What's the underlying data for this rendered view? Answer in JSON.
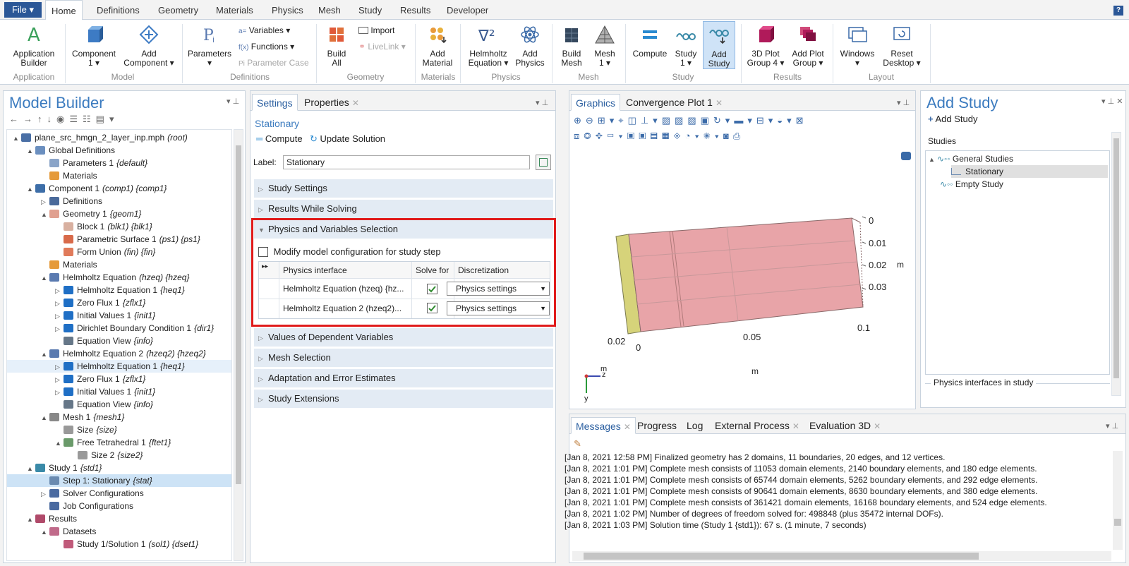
{
  "ribbon": {
    "file_label": "File ▾",
    "tabs": [
      "Home",
      "Definitions",
      "Geometry",
      "Materials",
      "Physics",
      "Mesh",
      "Study",
      "Results",
      "Developer"
    ],
    "help_label": "?",
    "groups": {
      "application": "Application",
      "model": "Model",
      "definitions": "Definitions",
      "geometry": "Geometry",
      "materials": "Materials",
      "physics": "Physics",
      "mesh": "Mesh",
      "study": "Study",
      "results": "Results",
      "layout": "Layout"
    },
    "buttons": {
      "app_builder_1": "Application",
      "app_builder_2": "Builder",
      "component_1": "Component",
      "component_2": "1 ▾",
      "add_component_1": "Add",
      "add_component_2": "Component ▾",
      "parameters_1": "Parameters",
      "parameters_2": "▾",
      "variables": "Variables ▾",
      "functions": "Functions ▾",
      "parameter_case": "Parameter Case",
      "build_all_1": "Build",
      "build_all_2": "All",
      "import": "Import",
      "livelink": "LiveLink ▾",
      "add_material_1": "Add",
      "add_material_2": "Material",
      "helmholtz_1": "Helmholtz",
      "helmholtz_2": "Equation ▾",
      "add_physics_1": "Add",
      "add_physics_2": "Physics",
      "build_mesh_1": "Build",
      "build_mesh_2": "Mesh",
      "mesh_1": "Mesh",
      "mesh_2": "1 ▾",
      "compute": "Compute",
      "study_1": "Study",
      "study_2": "1 ▾",
      "add_study_1": "Add",
      "add_study_2": "Study",
      "plot3d_1": "3D Plot",
      "plot3d_2": "Group 4 ▾",
      "add_plot_1": "Add Plot",
      "add_plot_2": "Group ▾",
      "windows_1": "Windows",
      "windows_2": "▾",
      "reset_1": "Reset",
      "reset_2": "Desktop ▾"
    }
  },
  "model_builder": {
    "title": "Model Builder",
    "tree": [
      {
        "level": 0,
        "tw": "▲",
        "label": "plane_src_hmgn_2_layer_inp.mph",
        "tag": "(root)",
        "icon": "#4a6fa5"
      },
      {
        "level": 1,
        "tw": "▲",
        "label": "Global Definitions",
        "tag": "",
        "icon": "#6b8fbf"
      },
      {
        "level": 2,
        "tw": "",
        "label": "Parameters 1",
        "tag": "{default}",
        "icon": "#8aa4c8"
      },
      {
        "level": 2,
        "tw": "",
        "label": "Materials",
        "tag": "",
        "icon": "#e59a3a"
      },
      {
        "level": 1,
        "tw": "▲",
        "label": "Component 1",
        "tag": "(comp1) {comp1}",
        "icon": "#3d6ea8"
      },
      {
        "level": 2,
        "tw": "▷",
        "label": "Definitions",
        "tag": "",
        "icon": "#4a6a9a"
      },
      {
        "level": 2,
        "tw": "▲",
        "label": "Geometry 1",
        "tag": "{geom1}",
        "icon": "#e0a090"
      },
      {
        "level": 3,
        "tw": "",
        "label": "Block 1",
        "tag": "(blk1) {blk1}",
        "icon": "#d8b0a0"
      },
      {
        "level": 3,
        "tw": "",
        "label": "Parametric Surface 1",
        "tag": "(ps1) {ps1}",
        "icon": "#d86a4a"
      },
      {
        "level": 3,
        "tw": "",
        "label": "Form Union",
        "tag": "(fin) {fin}",
        "icon": "#e07a5a"
      },
      {
        "level": 2,
        "tw": "",
        "label": "Materials",
        "tag": "",
        "icon": "#e59a3a"
      },
      {
        "level": 2,
        "tw": "▲",
        "label": "Helmholtz Equation",
        "tag": "(hzeq) {hzeq}",
        "icon": "#5a7ab0"
      },
      {
        "level": 3,
        "tw": "▷",
        "label": "Helmholtz Equation 1",
        "tag": "{heq1}",
        "icon": "#1f6fc5"
      },
      {
        "level": 3,
        "tw": "▷",
        "label": "Zero Flux 1",
        "tag": "{zflx1}",
        "icon": "#1f6fc5"
      },
      {
        "level": 3,
        "tw": "▷",
        "label": "Initial Values 1",
        "tag": "{init1}",
        "icon": "#1f6fc5"
      },
      {
        "level": 3,
        "tw": "▷",
        "label": "Dirichlet Boundary Condition 1",
        "tag": "{dir1}",
        "icon": "#1f6fc5"
      },
      {
        "level": 3,
        "tw": "",
        "label": "Equation View",
        "tag": "{info}",
        "icon": "#667788"
      },
      {
        "level": 2,
        "tw": "▲",
        "label": "Helmholtz Equation 2",
        "tag": "(hzeq2) {hzeq2}",
        "icon": "#5a7ab0"
      },
      {
        "level": 3,
        "tw": "▷",
        "label": "Helmholtz Equation 1",
        "tag": "{heq1}",
        "icon": "#1f6fc5",
        "highlight": true
      },
      {
        "level": 3,
        "tw": "▷",
        "label": "Zero Flux 1",
        "tag": "{zflx1}",
        "icon": "#1f6fc5"
      },
      {
        "level": 3,
        "tw": "▷",
        "label": "Initial Values 1",
        "tag": "{init1}",
        "icon": "#1f6fc5"
      },
      {
        "level": 3,
        "tw": "",
        "label": "Equation View",
        "tag": "{info}",
        "icon": "#667788"
      },
      {
        "level": 2,
        "tw": "▲",
        "label": "Mesh 1",
        "tag": "{mesh1}",
        "icon": "#888888"
      },
      {
        "level": 3,
        "tw": "",
        "label": "Size",
        "tag": "{size}",
        "icon": "#999999"
      },
      {
        "level": 3,
        "tw": "▲",
        "label": "Free Tetrahedral 1",
        "tag": "{ftet1}",
        "icon": "#6a9a6a"
      },
      {
        "level": 4,
        "tw": "",
        "label": "Size 2",
        "tag": "{size2}",
        "icon": "#999999"
      },
      {
        "level": 1,
        "tw": "▲",
        "label": "Study 1",
        "tag": "{std1}",
        "icon": "#3a8aa8"
      },
      {
        "level": 2,
        "tw": "",
        "label": "Step 1: Stationary",
        "tag": "{stat}",
        "icon": "#6a8ab0",
        "selected": true
      },
      {
        "level": 2,
        "tw": "▷",
        "label": "Solver Configurations",
        "tag": "",
        "icon": "#4a6aa0"
      },
      {
        "level": 2,
        "tw": "",
        "label": "Job Configurations",
        "tag": "",
        "icon": "#4a6aa0"
      },
      {
        "level": 1,
        "tw": "▲",
        "label": "Results",
        "tag": "",
        "icon": "#b04a6a"
      },
      {
        "level": 2,
        "tw": "▲",
        "label": "Datasets",
        "tag": "",
        "icon": "#c06a8a"
      },
      {
        "level": 3,
        "tw": "",
        "label": "Study 1/Solution 1",
        "tag": "(sol1) {dset1}",
        "icon": "#c05a7a"
      }
    ]
  },
  "settings": {
    "tab_settings": "Settings",
    "tab_properties": "Properties",
    "node_title": "Stationary",
    "compute": "Compute",
    "update_solution": "Update Solution",
    "label_caption": "Label:",
    "label_value": "Stationary",
    "sections": [
      "Study Settings",
      "Results While Solving",
      "Physics and Variables Selection",
      "Values of Dependent Variables",
      "Mesh Selection",
      "Adaptation and Error Estimates",
      "Study Extensions"
    ],
    "modify_config": "Modify model configuration for study step",
    "table": {
      "expand_icon": "▸▸",
      "headers": [
        "Physics interface",
        "Solve for",
        "Discretization"
      ],
      "rows": [
        {
          "interface": "Helmholtz Equation (hzeq) {hz...",
          "solve": true,
          "discretization": "Physics settings"
        },
        {
          "interface": "Helmholtz Equation 2 (hzeq2)...",
          "solve": true,
          "discretization": "Physics settings"
        }
      ]
    }
  },
  "graphics": {
    "tab_graphics": "Graphics",
    "tab_convergence": "Convergence Plot 1",
    "axis": {
      "right_ticks": [
        "0",
        "0.01",
        "0.02",
        "0.03"
      ],
      "right_unit": "m",
      "bottom_ticks": [
        "0.05",
        "0.1"
      ],
      "left_ticks": [
        "0.02",
        "0"
      ],
      "bottom_unit": "m",
      "triad_m": "m",
      "triad_z": "z",
      "triad_y": "y"
    },
    "body_color": "#e8a4a8",
    "layer_color": "#d6d37a"
  },
  "add_study": {
    "title": "Add Study",
    "add_button": "Add Study",
    "studies_caption": "Studies",
    "general_studies": "General Studies",
    "stationary": "Stationary",
    "empty_study": "Empty Study",
    "physics_caption": "Physics interfaces in study"
  },
  "messages": {
    "tabs": [
      "Messages",
      "Progress",
      "Log",
      "External Process",
      "Evaluation 3D"
    ],
    "lines": [
      "[Jan 8, 2021 12:58 PM] Finalized geometry has 2 domains, 11 boundaries, 20 edges, and 12 vertices.",
      "[Jan 8, 2021 1:01 PM] Complete mesh consists of 11053 domain elements, 2140 boundary elements, and 180 edge elements.",
      "[Jan 8, 2021 1:01 PM] Complete mesh consists of 65744 domain elements, 5262 boundary elements, and 292 edge elements.",
      "[Jan 8, 2021 1:01 PM] Complete mesh consists of 90641 domain elements, 8630 boundary elements, and 380 edge elements.",
      "[Jan 8, 2021 1:01 PM] Complete mesh consists of 361421 domain elements, 16168 boundary elements, and 524 edge elements.",
      "[Jan 8, 2021 1:02 PM] Number of degrees of freedom solved for: 498848 (plus 35472 internal DOFs).",
      "[Jan 8, 2021 1:03 PM] Solution time (Study 1 {std1}): 67 s. (1 minute, 7 seconds)"
    ]
  },
  "colors": {
    "accent": "#3b7bbf",
    "highlight_box": "#e01b1b",
    "file_button": "#2b5797"
  }
}
